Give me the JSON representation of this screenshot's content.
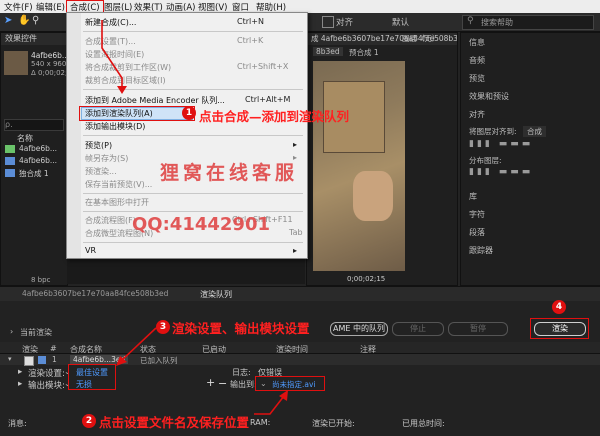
{
  "menubar": {
    "items": [
      "文件(F)",
      "编辑(E)",
      "合成(C)",
      "图层(L)",
      "效果(T)",
      "动画(A)",
      "视图(V)",
      "窗口",
      "帮助(H)"
    ]
  },
  "toolbar": {
    "snap_label": "对齐",
    "workspace_label": "默认",
    "search_placeholder": "搜索帮助"
  },
  "project_panel": {
    "tab_effects": "效果控件",
    "item_name": "4afbe6b...",
    "item_info": "540 x 960 (1.00)",
    "item_info2": "Δ 0;00;02;...",
    "search_glyph": "ρ.",
    "col_name": "名称",
    "rows": [
      "4afbe6b...",
      "4afbe6b...",
      "独合成 1"
    ],
    "bpc": "8 bpc"
  },
  "comp_panel": {
    "tab_title": "成 4afbe6b3607be17e70aa84fce508b3ed",
    "sub_tab": "8b3ed",
    "layer_tab": "图层（无）",
    "pre_render": "预合成 1",
    "timecode": "0;00;02;15"
  },
  "dropdown": {
    "items": [
      {
        "label": "新建合成(C)...",
        "shortcut": "Ctrl+N",
        "disabled": false
      },
      {
        "label": "合成设置(T)...",
        "shortcut": "Ctrl+K",
        "disabled": true
      },
      {
        "label": "设置海报时间(E)",
        "shortcut": "",
        "disabled": true
      },
      {
        "label": "将合成裁剪到工作区(W)",
        "shortcut": "Ctrl+Shift+X",
        "disabled": true
      },
      {
        "label": "裁剪合成到目标区域(I)",
        "shortcut": "",
        "disabled": true
      },
      {
        "label": "添加到 Adobe Media Encoder 队列...",
        "shortcut": "Ctrl+Alt+M",
        "disabled": false
      },
      {
        "label": "添加到渲染队列(A)",
        "shortcut": "",
        "disabled": false
      },
      {
        "label": "添加输出模块(D)",
        "shortcut": "",
        "disabled": false
      },
      {
        "label": "预览(P)",
        "shortcut": "",
        "disabled": false
      },
      {
        "label": "帧另存为(S)",
        "shortcut": "",
        "disabled": true
      },
      {
        "label": "预渲染...",
        "shortcut": "",
        "disabled": true
      },
      {
        "label": "保存当前预览(V)...",
        "shortcut": "",
        "disabled": true
      },
      {
        "label": "在基本图形中打开",
        "shortcut": "",
        "disabled": true
      },
      {
        "label": "合成流程图(F)",
        "shortcut": "Ctrl+Shift+F11",
        "disabled": true
      },
      {
        "label": "合成微型流程图(N)",
        "shortcut": "Tab",
        "disabled": true
      },
      {
        "label": "VR",
        "shortcut": "",
        "disabled": false
      }
    ]
  },
  "annotations": {
    "a1": "点击合成—添加到渲染队列",
    "a2": "点击设置文件名及保存位置",
    "a3": "渲染设置、输出模块设置",
    "n1": "1",
    "n2": "2",
    "n3": "3",
    "n4": "4",
    "watermark": "狸窝在线客服",
    "qq": "QQ:41442901"
  },
  "right_panel": {
    "items": [
      "信息",
      "音频",
      "预览",
      "效果和预设",
      "对齐",
      "将图层对齐到:",
      "合成",
      "分布图层:",
      "库",
      "字符",
      "段落",
      "跟踪器"
    ]
  },
  "render_queue": {
    "tab_comp": "4afbe6b3607be17e70aa84fce508b3ed",
    "tab_queue": "渲染队列",
    "current_render": "当前渲染",
    "ame_btn": "AME 中的队列",
    "stop_btn": "停止",
    "pause_btn": "暂停",
    "render_btn": "渲染",
    "columns": [
      "渲染",
      "#",
      "合成名称",
      "状态",
      "已启动",
      "渲染时间",
      "注释"
    ],
    "row_num": "1",
    "row_comp": "4afbe6b...3ed",
    "row_status": "已加入队列",
    "render_settings_label": "渲染设置:",
    "render_settings_value": "最佳设置",
    "log_label": "日志:",
    "log_value": "仅错误",
    "output_module_label": "输出模块:",
    "output_module_value": "无损",
    "output_to_label": "输出到:",
    "output_to_value": "尚未指定.avi",
    "msg_label": "消息:",
    "ram_label": "RAM:",
    "render_start_label": "渲染已开始:",
    "total_time_label": "已用总时间:"
  }
}
